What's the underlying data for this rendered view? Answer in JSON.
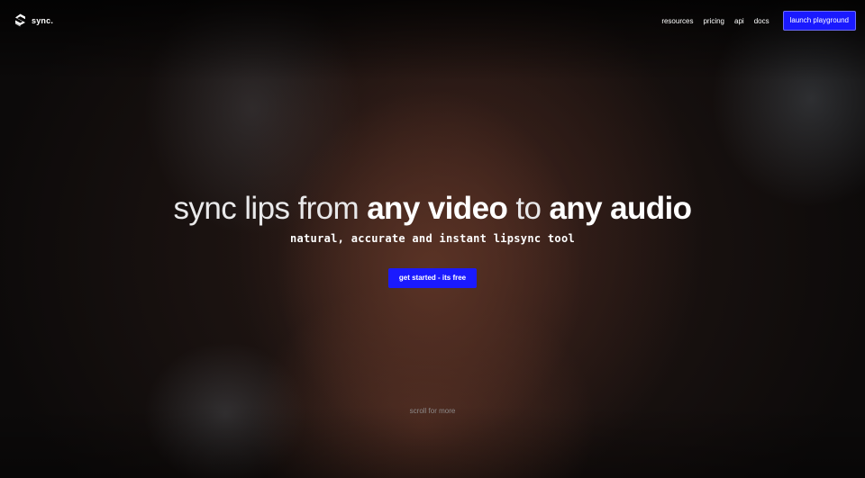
{
  "header": {
    "brand_name": "sync.",
    "brand_icon": "sync-logo-icon",
    "nav": {
      "resources": "resources",
      "pricing": "pricing",
      "api": "api",
      "docs": "docs"
    },
    "cta_label": "launch playground"
  },
  "hero": {
    "headline": {
      "part1": "sync lips from ",
      "part2": "any video",
      "part3": " to ",
      "part4": "any audio"
    },
    "subheadline": "natural, accurate and instant lipsync tool",
    "cta_label": "get started - its free",
    "scroll_hint": "scroll for more"
  },
  "colors": {
    "accent": "#1a1aff",
    "background": "#0a0808",
    "text": "#ffffff",
    "muted_text": "#8d8a8a"
  }
}
